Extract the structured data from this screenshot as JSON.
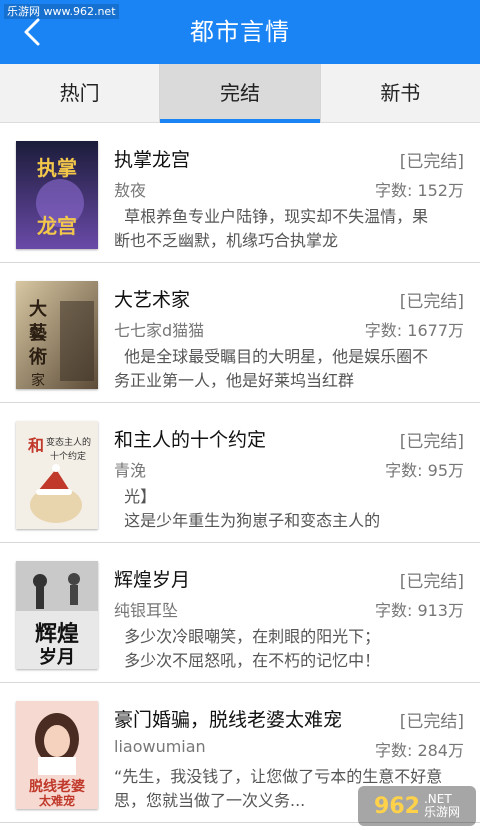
{
  "watermark_top": "乐游网 www.962.net",
  "header": {
    "title": "都市言情"
  },
  "tabs": [
    {
      "label": "热门",
      "active": false
    },
    {
      "label": "完结",
      "active": true
    },
    {
      "label": "新书",
      "active": false
    }
  ],
  "books": [
    {
      "title": "执掌龙宫",
      "status": "[已完结]",
      "author": "敖夜",
      "words": "字数: 152万",
      "desc": "  草根养鱼专业户陆铮，现实却不失温情，果断也不乏幽默，机缘巧合执掌龙",
      "cover_text": "执掌龙宫",
      "cover_colors": [
        "#1b1c3a",
        "#6a4aa8"
      ]
    },
    {
      "title": "大艺术家",
      "status": "[已完结]",
      "author": "七七家d猫猫",
      "words": "字数: 1677万",
      "desc": "  他是全球最受瞩目的大明星，他是娱乐圈不务正业第一人，他是好莱坞当红群",
      "cover_text": "大艺术家",
      "cover_colors": [
        "#c9b48e",
        "#5b4b38"
      ]
    },
    {
      "title": "和主人的十个约定",
      "status": "[已完结]",
      "author": "青浼",
      "words": "字数: 95万",
      "desc": "  光】\n  这是少年重生为狗崽子和变态主人的",
      "cover_text": "变态主人的十个约定",
      "cover_colors": [
        "#f4efe6",
        "#c0392b"
      ]
    },
    {
      "title": "辉煌岁月",
      "status": "[已完结]",
      "author": "纯银耳坠",
      "words": "字数: 913万",
      "desc": "  多少次冷眼嘲笑，在刺眼的阳光下；\n  多少次不屈怒吼，在不朽的记忆中！",
      "cover_text": "辉煌岁月",
      "cover_colors": [
        "#e8e8e8",
        "#222222"
      ]
    },
    {
      "title": "豪门婚骗，脱线老婆太难宠",
      "status": "[已完结]",
      "author": "liaowumian",
      "words": "字数: 284万",
      "desc": "“先生，我没钱了，让您做了亏本的生意不好意思，您就当做了一次义务...",
      "cover_text": "脱线老婆太难宠",
      "cover_colors": [
        "#f6d9d0",
        "#c0392b"
      ]
    }
  ],
  "watermark_bottom": {
    "big": "962",
    "net": ".NET",
    "cn": "乐游网"
  }
}
